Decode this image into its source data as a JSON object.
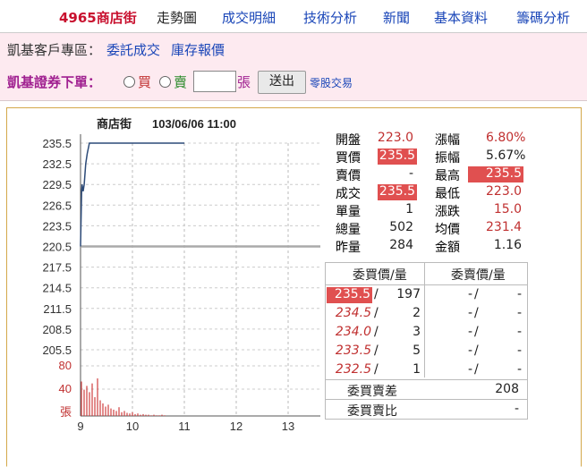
{
  "nav": {
    "stock": "4965商店街",
    "current": "走勢圖",
    "items": [
      "成交明細",
      "技術分析",
      "新聞",
      "基本資料",
      "籌碼分析"
    ]
  },
  "account": {
    "label": "凱基客戶專區：",
    "links": [
      "委託成交",
      "庫存報價"
    ]
  },
  "order": {
    "brand": "凱基證券下單：",
    "buy": "買",
    "sell": "賣",
    "unit": "張",
    "send": "送出",
    "oddlot": "零股交易",
    "quantity": ""
  },
  "colors": {
    "red": "#c03030",
    "highlight": "#e05050",
    "line": "#2c4a78",
    "brand": "#a02090"
  },
  "chart_data": {
    "type": "line",
    "title": "商店街",
    "timestamp": "103/06/06 11:00",
    "yticks": [
      "235.5",
      "232.5",
      "229.5",
      "226.5",
      "223.5",
      "220.5",
      "217.5",
      "214.5",
      "211.5",
      "208.5",
      "205.5"
    ],
    "xticks": [
      "9",
      "10",
      "11",
      "12",
      "13"
    ],
    "ylim": [
      205.5,
      235.5
    ],
    "reference": 220.5,
    "price": {
      "x": [
        9.0,
        9.02,
        9.03,
        9.05,
        9.07,
        9.1,
        9.13,
        9.17,
        9.25,
        10.0,
        11.0
      ],
      "y": [
        220.5,
        228.5,
        229.5,
        228.5,
        229.5,
        232.5,
        234.0,
        235.5,
        235.5,
        235.5,
        235.5
      ]
    },
    "volume_labels": [
      "80",
      "40",
      "張"
    ],
    "volume_max": 80,
    "volume": [
      55,
      42,
      48,
      38,
      52,
      30,
      60,
      25,
      20,
      15,
      18,
      12,
      10,
      8,
      14,
      6,
      8,
      5,
      4,
      6,
      3,
      4,
      2,
      3,
      2,
      2,
      1,
      2,
      1,
      1,
      2,
      1
    ]
  },
  "quote": [
    {
      "l1": "開盤",
      "v1": "223.0",
      "l2": "漲幅",
      "v2": "6.80%"
    },
    {
      "l1": "買價",
      "v1": "235.5",
      "l2": "振幅",
      "v2": "5.67%"
    },
    {
      "l1": "賣價",
      "v1": "-",
      "l2": "最高",
      "v2": "235.5"
    },
    {
      "l1": "成交",
      "v1": "235.5",
      "l2": "最低",
      "v2": "223.0"
    },
    {
      "l1": "單量",
      "v1": "1",
      "l2": "漲跌",
      "v2": "15.0"
    },
    {
      "l1": "總量",
      "v1": "502",
      "l2": "均價",
      "v2": "231.4"
    },
    {
      "l1": "昨量",
      "v1": "284",
      "l2": "金額",
      "v2": "1.16"
    }
  ],
  "orderbook": {
    "bid_header": "委買價/量",
    "ask_header": "委賣價/量",
    "rows": [
      {
        "bid": "235.5",
        "bidqty": "197",
        "ask": "-",
        "askqty": "-"
      },
      {
        "bid": "234.5",
        "bidqty": "2",
        "ask": "-",
        "askqty": "-"
      },
      {
        "bid": "234.0",
        "bidqty": "3",
        "ask": "-",
        "askqty": "-"
      },
      {
        "bid": "233.5",
        "bidqty": "5",
        "ask": "-",
        "askqty": "-"
      },
      {
        "bid": "232.5",
        "bidqty": "1",
        "ask": "-",
        "askqty": "-"
      }
    ],
    "diff_label": "委買賣差",
    "diff_value": "208",
    "ratio_label": "委買賣比",
    "ratio_value": "-"
  }
}
